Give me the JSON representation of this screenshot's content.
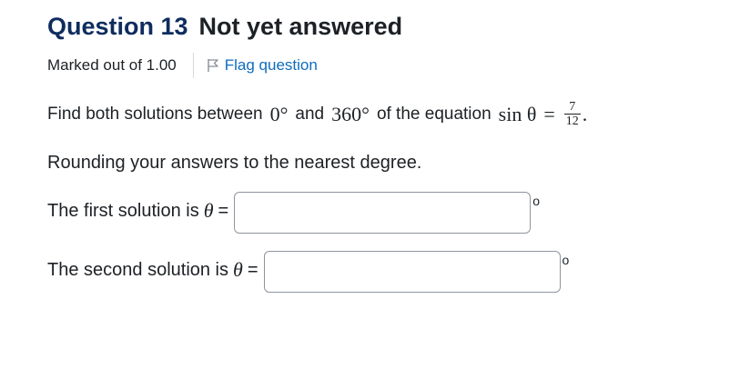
{
  "question": {
    "number_label": "Question 13",
    "status": "Not yet answered",
    "marked_out_of": "Marked out of 1.00",
    "flag_label": "Flag question"
  },
  "problem": {
    "text_before": "Find both solutions between",
    "angle_low": "0°",
    "text_and": "and",
    "angle_high": "360°",
    "text_equation": "of the equation",
    "sin_theta": "sin θ",
    "equals": "=",
    "fraction_numerator": "7",
    "fraction_denominator": "12",
    "period": ".",
    "rounding_instruction": "Rounding your answers to the nearest degree."
  },
  "answers": [
    {
      "label": "The first solution is",
      "symbol": "θ",
      "equals": "=",
      "value": "",
      "unit": "o"
    },
    {
      "label": "The second solution is",
      "symbol": "θ",
      "equals": "=",
      "value": "",
      "unit": "o"
    }
  ],
  "colors": {
    "question_number": "#0f2c5e",
    "flag_link": "#0f6cbf"
  },
  "icons": {
    "flag": "flag-icon"
  }
}
